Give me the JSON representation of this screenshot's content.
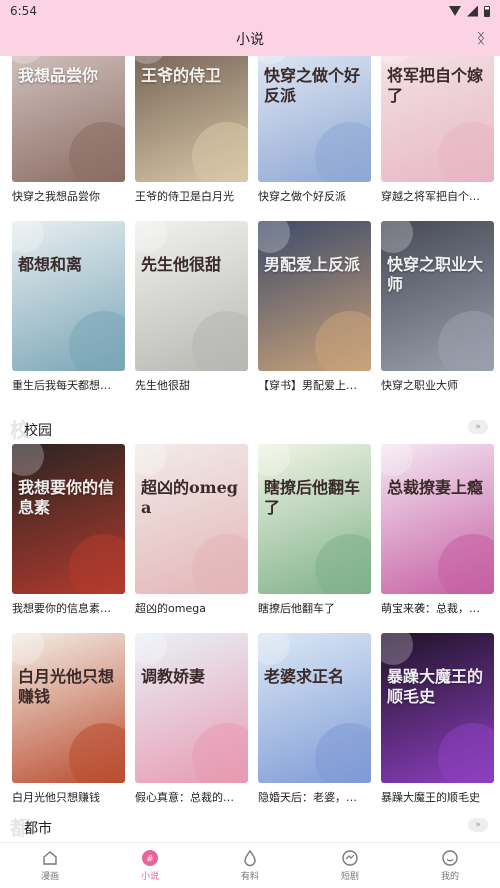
{
  "status": {
    "time": "6:54"
  },
  "header": {
    "title": "小说",
    "action_icon": "x-icon"
  },
  "sections": [
    {
      "books": [
        {
          "title": "快穿之我想品尝你",
          "cover_text": "我想品尝你",
          "bg": "#d9cbc6",
          "fg": "#8b6d64",
          "dark": false
        },
        {
          "title": "王爷的侍卫是白月光",
          "cover_text": "王爷的侍卫",
          "bg": "#6b5a4e",
          "fg": "#d9c7a8",
          "dark": false
        },
        {
          "title": "快穿之做个好反派",
          "cover_text": "快穿之做个好反派",
          "bg": "#e9eef6",
          "fg": "#8ea7d4",
          "dark": true
        },
        {
          "title": "穿越之将军把自个…",
          "cover_text": "将军把自个嫁了",
          "bg": "#f5e7ea",
          "fg": "#e7b6c3",
          "dark": true
        },
        {
          "title": "重生后我每天都想…",
          "cover_text": "都想和离",
          "bg": "#e8eef1",
          "fg": "#7aa6b7",
          "dark": true
        },
        {
          "title": "先生他很甜",
          "cover_text": "先生他很甜",
          "bg": "#f1f1ef",
          "fg": "#b7b7b2",
          "dark": true
        },
        {
          "title": "【穿书】男配爱上…",
          "cover_text": "男配爱上反派",
          "bg": "#3e4b68",
          "fg": "#c9a27a",
          "dark": false
        },
        {
          "title": "快穿之职业大师",
          "cover_text": "快穿之职业大师",
          "bg": "#474a55",
          "fg": "#9aa0ad",
          "dark": false
        }
      ]
    },
    {
      "name": "校园",
      "bg_text": "校",
      "more": "»",
      "books": [
        {
          "title": "我想要你的信息素…",
          "cover_text": "我想要你的信息素",
          "bg": "#2b2422",
          "fg": "#b23b2e",
          "dark": false
        },
        {
          "title": "超凶的omega",
          "cover_text": "超凶的omega",
          "bg": "#f2ece9",
          "fg": "#e3b4b7",
          "dark": true
        },
        {
          "title": "瞎撩后他翻车了",
          "cover_text": "瞎撩后他翻车了",
          "bg": "#f0f4e4",
          "fg": "#7fb18c",
          "dark": true
        },
        {
          "title": "萌宝来袭：总裁，…",
          "cover_text": "总裁撩妻上瘾",
          "bg": "#f4e8f3",
          "fg": "#c65fa3",
          "dark": true
        },
        {
          "title": "白月光他只想赚钱",
          "cover_text": "白月光他只想赚钱",
          "bg": "#f4eee6",
          "fg": "#b94c2f",
          "dark": true
        },
        {
          "title": "假心真意：总裁的…",
          "cover_text": "调教娇妻",
          "bg": "#e9f2f7",
          "fg": "#e79ab2",
          "dark": true
        },
        {
          "title": "隐婚天后：老婆，…",
          "cover_text": "老婆求正名",
          "bg": "#dbe8f5",
          "fg": "#7f9bd6",
          "dark": true
        },
        {
          "title": "暴躁大魔王的顺毛史",
          "cover_text": "暴躁大魔王的顺毛史",
          "bg": "#1f1328",
          "fg": "#8d3fbf",
          "dark": false
        }
      ]
    },
    {
      "name": "都市",
      "bg_text": "都",
      "more": "»"
    }
  ],
  "tabs": [
    {
      "label": "漫画",
      "icon": "home-icon",
      "active": false
    },
    {
      "label": "小说",
      "icon": "novel-icon",
      "active": true
    },
    {
      "label": "有料",
      "icon": "drop-icon",
      "active": false
    },
    {
      "label": "短剧",
      "icon": "play-icon",
      "active": false
    },
    {
      "label": "我的",
      "icon": "profile-icon",
      "active": false
    }
  ],
  "colors": {
    "header_bg": "#fbd3e3",
    "accent": "#e8659a"
  }
}
